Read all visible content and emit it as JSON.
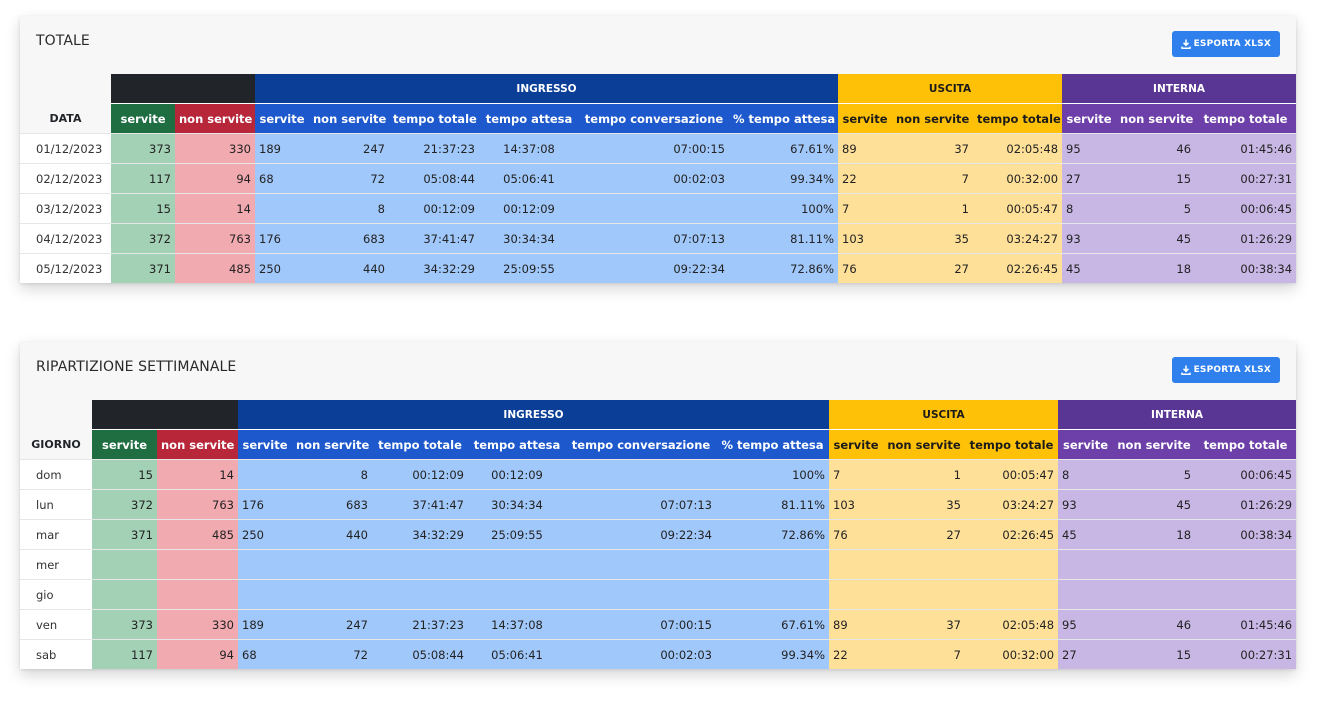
{
  "export_label": "ESPORTA XLSX",
  "groups": {
    "ingresso": "INGRESSO",
    "uscita": "USCITA",
    "interna": "INTERNA"
  },
  "sub": {
    "servite": "servite",
    "non_servite": "non servite",
    "tempo_totale": "tempo totale",
    "tempo_attesa": "tempo attesa",
    "tempo_conversazione": "tempo conversazione",
    "perc_attesa": "% tempo attesa"
  },
  "totale": {
    "title": "TOTALE",
    "first_col": "DATA",
    "rows": [
      [
        "01/12/2023",
        "373",
        "330",
        "189",
        "247",
        "21:37:23",
        "14:37:08",
        "07:00:15",
        "67.61%",
        "89",
        "37",
        "02:05:48",
        "95",
        "46",
        "01:45:46"
      ],
      [
        "02/12/2023",
        "117",
        "94",
        "68",
        "72",
        "05:08:44",
        "05:06:41",
        "00:02:03",
        "99.34%",
        "22",
        "7",
        "00:32:00",
        "27",
        "15",
        "00:27:31"
      ],
      [
        "03/12/2023",
        "15",
        "14",
        "",
        "8",
        "00:12:09",
        "00:12:09",
        "",
        "100%",
        "7",
        "1",
        "00:05:47",
        "8",
        "5",
        "00:06:45"
      ],
      [
        "04/12/2023",
        "372",
        "763",
        "176",
        "683",
        "37:41:47",
        "30:34:34",
        "07:07:13",
        "81.11%",
        "103",
        "35",
        "03:24:27",
        "93",
        "45",
        "01:26:29"
      ],
      [
        "05/12/2023",
        "371",
        "485",
        "250",
        "440",
        "34:32:29",
        "25:09:55",
        "09:22:34",
        "72.86%",
        "76",
        "27",
        "02:26:45",
        "45",
        "18",
        "00:38:34"
      ]
    ]
  },
  "settimanale": {
    "title": "RIPARTIZIONE SETTIMANALE",
    "first_col": "GIORNO",
    "rows": [
      [
        "dom",
        "15",
        "14",
        "",
        "8",
        "00:12:09",
        "00:12:09",
        "",
        "100%",
        "7",
        "1",
        "00:05:47",
        "8",
        "5",
        "00:06:45"
      ],
      [
        "lun",
        "372",
        "763",
        "176",
        "683",
        "37:41:47",
        "30:34:34",
        "07:07:13",
        "81.11%",
        "103",
        "35",
        "03:24:27",
        "93",
        "45",
        "01:26:29"
      ],
      [
        "mar",
        "371",
        "485",
        "250",
        "440",
        "34:32:29",
        "25:09:55",
        "09:22:34",
        "72.86%",
        "76",
        "27",
        "02:26:45",
        "45",
        "18",
        "00:38:34"
      ],
      [
        "mer",
        "",
        "",
        "",
        "",
        "",
        "",
        "",
        "",
        "",
        "",
        "",
        "",
        "",
        ""
      ],
      [
        "gio",
        "",
        "",
        "",
        "",
        "",
        "",
        "",
        "",
        "",
        "",
        "",
        "",
        "",
        ""
      ],
      [
        "ven",
        "373",
        "330",
        "189",
        "247",
        "21:37:23",
        "14:37:08",
        "07:00:15",
        "67.61%",
        "89",
        "37",
        "02:05:48",
        "95",
        "46",
        "01:45:46"
      ],
      [
        "sab",
        "117",
        "94",
        "68",
        "72",
        "05:08:44",
        "05:06:41",
        "00:02:03",
        "99.34%",
        "22",
        "7",
        "00:32:00",
        "27",
        "15",
        "00:27:31"
      ]
    ]
  }
}
